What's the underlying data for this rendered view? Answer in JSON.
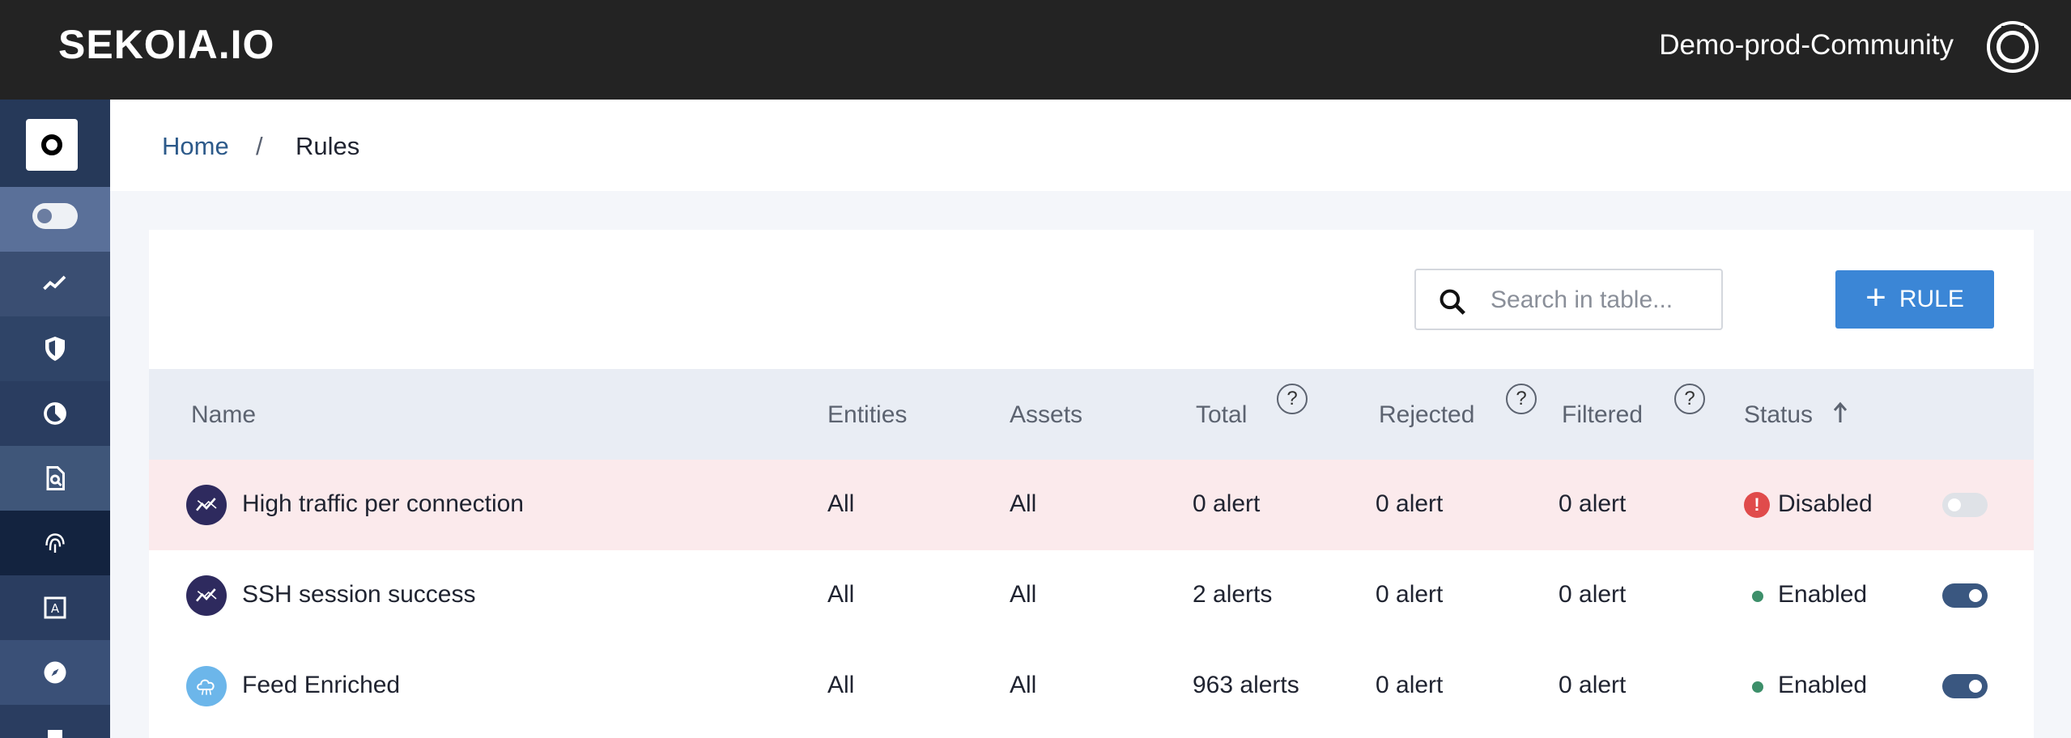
{
  "header": {
    "brand": "SEKOIA.IO",
    "community": "Demo-prod-Community",
    "avatar_icon": "user-avatar-icon"
  },
  "sidebar": {
    "items": [
      {
        "name": "sidebar-item-toggle",
        "icon": "toggle-icon"
      },
      {
        "name": "sidebar-item-activity",
        "icon": "trend-icon"
      },
      {
        "name": "sidebar-item-security",
        "icon": "shield-icon"
      },
      {
        "name": "sidebar-item-dashboard",
        "icon": "gauge-icon"
      },
      {
        "name": "sidebar-item-investigate",
        "icon": "file-search-icon"
      },
      {
        "name": "sidebar-item-fingerprint",
        "icon": "fingerprint-icon"
      },
      {
        "name": "sidebar-item-assets",
        "icon": "frame-icon"
      },
      {
        "name": "sidebar-item-explore",
        "icon": "compass-icon"
      },
      {
        "name": "sidebar-item-docs",
        "icon": "book-icon"
      }
    ]
  },
  "breadcrumb": {
    "home": "Home",
    "separator": "/",
    "current": "Rules"
  },
  "toolbar": {
    "search_placeholder": "Search in table...",
    "add_label": "RULE",
    "add_color": "#3b86d6"
  },
  "table": {
    "columns": {
      "name": "Name",
      "entities": "Entities",
      "assets": "Assets",
      "total": "Total",
      "rejected": "Rejected",
      "filtered": "Filtered",
      "status": "Status"
    },
    "help_label": "?",
    "rows": [
      {
        "name": "High traffic per connection",
        "entities": "All",
        "assets": "All",
        "total": "0 alert",
        "rejected": "0 alert",
        "filtered": "0 alert",
        "status": "Disabled",
        "alert_mark": "!"
      },
      {
        "name": "SSH session success",
        "entities": "All",
        "assets": "All",
        "total": "2 alerts",
        "rejected": "0 alert",
        "filtered": "0 alert",
        "status": "Enabled"
      },
      {
        "name": "Feed Enriched",
        "entities": "All",
        "assets": "All",
        "total": "963 alerts",
        "rejected": "0 alert",
        "filtered": "0 alert",
        "status": "Enabled"
      }
    ]
  },
  "colors": {
    "topbar": "#232323",
    "sidebar": "#263959",
    "disabled_row": "#fbeaec",
    "enabled_dot": "#3d8f6a",
    "disabled_icon": "#e04b4b"
  }
}
